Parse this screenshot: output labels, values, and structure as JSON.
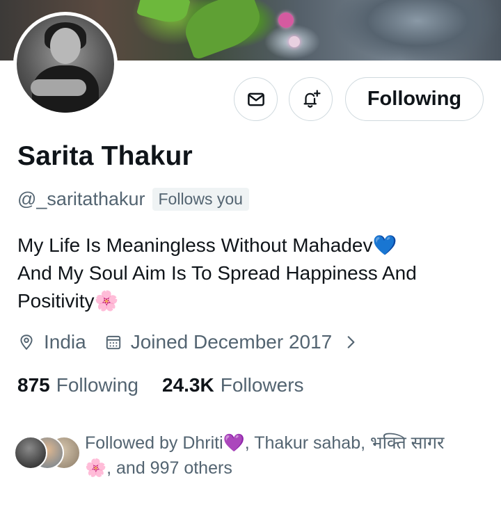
{
  "profile": {
    "name": "Sarita Thakur",
    "handle": "@_saritathakur",
    "follows_you_badge": "Follows you",
    "bio_lines": [
      "My Life Is Meaningless Without Mahadev💙",
      "And My Soul Aim Is To Spread  Happiness And",
      "Positivity🌸"
    ],
    "location": "India",
    "joined": "Joined December 2017",
    "following_count": "875",
    "following_label": "Following",
    "followers_count": "24.3K",
    "followers_label": "Followers"
  },
  "actions": {
    "message_icon": "mail-icon",
    "notify_icon": "bell-plus-icon",
    "follow_button_label": "Following"
  },
  "followed_by": {
    "line1": "Followed by Dhriti💜, Thakur sahab, भक्ति सागर",
    "line2": "🌸, and 997 others"
  },
  "colors": {
    "text_primary": "#0f1419",
    "text_secondary": "#536471",
    "border": "#cfd9de",
    "badge_bg": "#eff3f4"
  }
}
